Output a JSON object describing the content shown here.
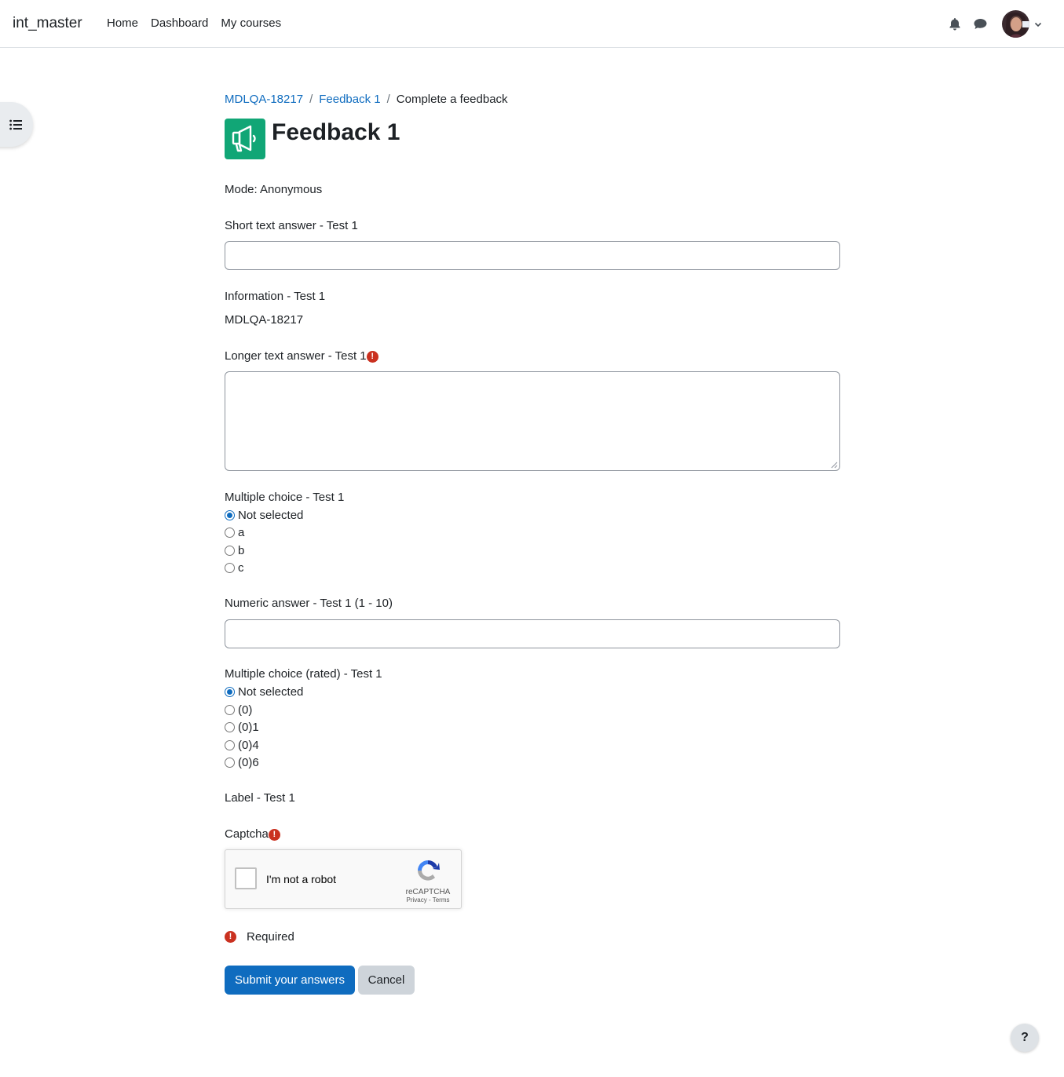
{
  "navbar": {
    "brand": "int_master",
    "links": [
      "Home",
      "Dashboard",
      "My courses"
    ],
    "icons": [
      "bell-icon",
      "chat-bubble-icon"
    ]
  },
  "breadcrumb": {
    "items": [
      "MDLQA-18217",
      "Feedback 1",
      "Complete a feedback"
    ],
    "separator": "/"
  },
  "page": {
    "title": "Feedback 1",
    "icon": "megaphone-icon",
    "accent_color": "#11a676"
  },
  "form": {
    "mode": "Mode: Anonymous",
    "short_text_label": "Short text answer - Test 1",
    "info_label": "Information - Test 1",
    "info_value": "MDLQA-18217",
    "longer_text_label": "Longer text answer - Test 1",
    "multichoice_label": "Multiple choice - Test 1",
    "multichoice_options": [
      "Not selected",
      "a",
      "b",
      "c"
    ],
    "multichoice_selected": "Not selected",
    "numeric_label": "Numeric answer - Test 1 (1 - 10)",
    "rated_label": "Multiple choice (rated) - Test 1",
    "rated_options": [
      "Not selected",
      "(0)",
      "(0)1",
      "(0)4",
      "(0)6"
    ],
    "rated_selected": "Not selected",
    "label_item": "Label - Test 1",
    "captcha_label": "Captcha",
    "captcha_checkbox_text": "I'm not a robot",
    "captcha_brand": "reCAPTCHA",
    "captcha_links": "Privacy - Terms",
    "required_text": "Required",
    "required_icon": "!",
    "submit_label": "Submit your answers",
    "cancel_label": "Cancel"
  },
  "help": {
    "label": "?"
  },
  "colors": {
    "primary": "#0f6cbf",
    "danger": "#ca3120",
    "secondary": "#ced4da"
  }
}
